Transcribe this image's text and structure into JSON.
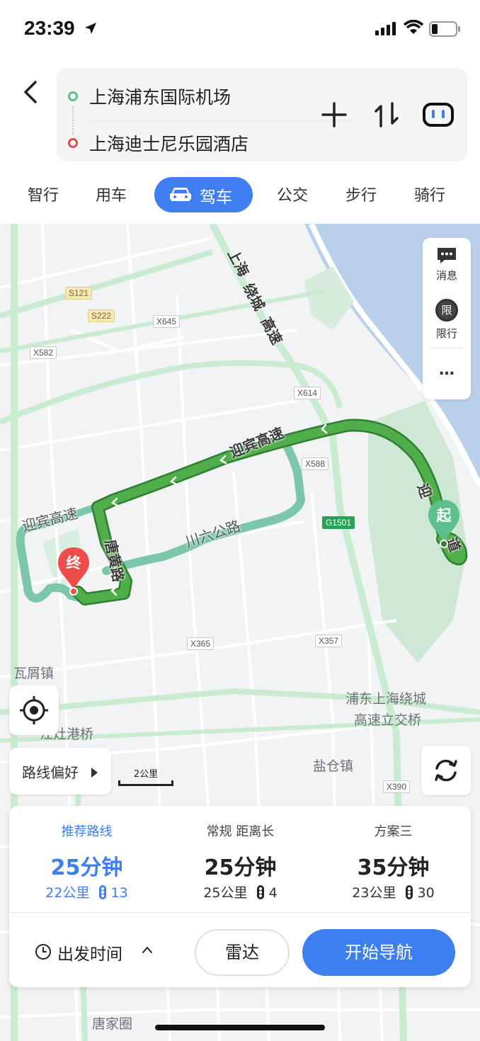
{
  "status_bar": {
    "time": "23:39"
  },
  "route": {
    "start": "上海浦东国际机场",
    "end": "上海迪士尼乐园酒店"
  },
  "tabs": [
    {
      "label": "智行"
    },
    {
      "label": "用车"
    },
    {
      "label": "驾车",
      "active": true
    },
    {
      "label": "公交"
    },
    {
      "label": "步行"
    },
    {
      "label": "骑行"
    }
  ],
  "map": {
    "labels": {
      "wawu": "瓦屑镇",
      "interchange_1": "浦东上海绕城",
      "interchange_2": "高速立交桥",
      "yancang": "盐仓镇",
      "tangjiaquan": "唐家圈",
      "zaogang": "江灶港桥"
    },
    "road_badges": {
      "s121": "S121",
      "s222": "S222",
      "x645": "X645",
      "x582": "X582",
      "x614": "X614",
      "x588": "X588",
      "g1501": "G1501",
      "x365": "X365",
      "x357": "X357",
      "x390": "X390"
    },
    "road_names": {
      "raocheng_1": "上海",
      "raocheng_2": "绕城",
      "raocheng_3": "高速",
      "yingbin_main": "迎宾高速",
      "yingbin_left": "迎宾高速",
      "tanghuang": "唐黄路",
      "chuanliu": "川六公路",
      "ying_partial": "迎",
      "dao_partial": "道"
    },
    "pins": {
      "start": "起",
      "end": "终"
    },
    "side_panel": {
      "message": "消息",
      "restrict": "限行",
      "restrict_icon": "限",
      "more": "…"
    },
    "route_pref": "路线偏好",
    "scale": "2公里"
  },
  "route_options": [
    {
      "name": "推荐路线",
      "duration": "25分钟",
      "distance": "22公里",
      "lights": "13",
      "selected": true
    },
    {
      "name": "常规  距离长",
      "duration": "25分钟",
      "distance": "25公里",
      "lights": "4"
    },
    {
      "name": "方案三",
      "duration": "35分钟",
      "distance": "23公里",
      "lights": "30"
    }
  ],
  "actions": {
    "depart_time": "出发时间",
    "radar": "雷达",
    "start_nav": "开始导航"
  },
  "colors": {
    "accent": "#3d7ef0",
    "route_green": "#4fae4a",
    "alt_route": "#7cc7a9",
    "water": "#b9d0ea",
    "park": "#cfe8d6",
    "start_pin": "#5cc08d",
    "end_pin": "#ee4b4b"
  }
}
